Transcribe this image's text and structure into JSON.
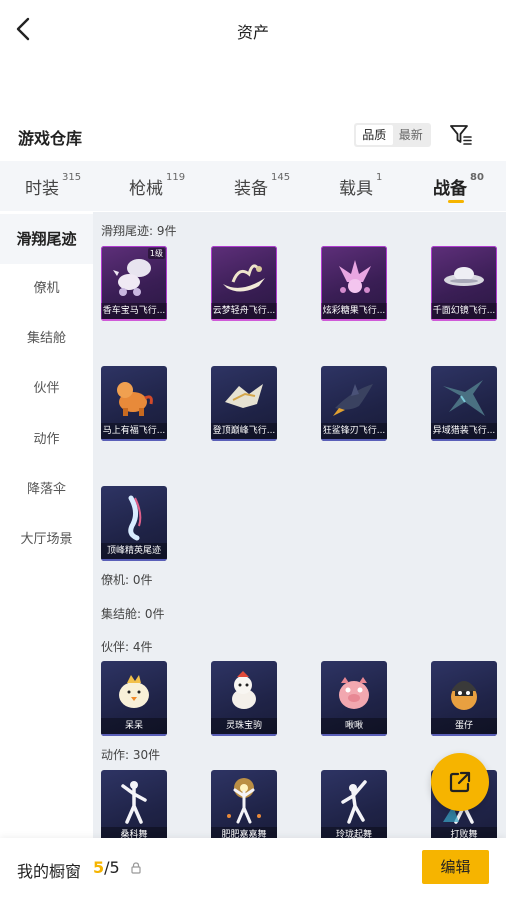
{
  "header": {
    "title": "资产"
  },
  "section": {
    "title": "游戏仓库",
    "sort_options": [
      "品质",
      "最新"
    ],
    "sort_active": "品质"
  },
  "tabs": [
    {
      "label": "时装",
      "count": "315"
    },
    {
      "label": "枪械",
      "count": "119"
    },
    {
      "label": "装备",
      "count": "145"
    },
    {
      "label": "载具",
      "count": "1"
    },
    {
      "label": "战备",
      "count": "80",
      "active": true
    }
  ],
  "sidebar": {
    "items": [
      {
        "label": "滑翔尾迹",
        "active": true
      },
      {
        "label": "僚机"
      },
      {
        "label": "集结舱"
      },
      {
        "label": "伙伴"
      },
      {
        "label": "动作"
      },
      {
        "label": "降落伞"
      },
      {
        "label": "大厅场景"
      }
    ]
  },
  "groups": {
    "glide": {
      "label": "滑翔尾迹: 9件",
      "items": [
        {
          "name": "香车宝马飞行...",
          "badge": "1级",
          "rarity": "purple",
          "icon": "horse-carriage-icon"
        },
        {
          "name": "云梦轻舟飞行...",
          "rarity": "purple",
          "icon": "lamp-boat-icon"
        },
        {
          "name": "炫彩糖果飞行...",
          "rarity": "purple",
          "icon": "candy-icon"
        },
        {
          "name": "千面幻镜飞行...",
          "rarity": "purple",
          "icon": "ufo-icon"
        },
        {
          "name": "马上有福飞行...",
          "rarity": "navy",
          "icon": "pony-icon"
        },
        {
          "name": "登顶巅峰飞行...",
          "rarity": "navy",
          "icon": "wings-icon"
        },
        {
          "name": "狂鲨锋刃飞行...",
          "rarity": "navy",
          "icon": "shark-icon"
        },
        {
          "name": "异域猎装飞行...",
          "rarity": "navy",
          "icon": "dragon-icon"
        },
        {
          "name": "顶峰精英尾迹",
          "rarity": "navy",
          "icon": "trail-icon"
        }
      ]
    },
    "drone": {
      "label": "僚机: 0件"
    },
    "pod": {
      "label": "集结舱: 0件"
    },
    "partner": {
      "label": "伙伴: 4件",
      "items": [
        {
          "name": "呆呆",
          "rarity": "navy",
          "icon": "chick-icon"
        },
        {
          "name": "灵珠宝驹",
          "rarity": "navy",
          "icon": "horse-icon"
        },
        {
          "name": "啾啾",
          "rarity": "navy",
          "icon": "pig-icon"
        },
        {
          "name": "蛋仔",
          "rarity": "navy",
          "icon": "egg-knight-icon"
        }
      ]
    },
    "emote": {
      "label": "动作: 30件",
      "items": [
        {
          "name": "桑科舞",
          "rarity": "navy",
          "icon": "dancer-icon"
        },
        {
          "name": "肥肥嘉嘉舞",
          "rarity": "navy",
          "icon": "firework-dancer-icon"
        },
        {
          "name": "玲珑起舞",
          "rarity": "navy",
          "icon": "dancer-icon"
        },
        {
          "name": "打败舞",
          "rarity": "navy",
          "icon": "dancer-icon"
        }
      ]
    }
  },
  "share": {
    "icon": "share-icon"
  },
  "bottom": {
    "label": "我的橱窗",
    "current": "5",
    "total": "/5",
    "edit_label": "编辑"
  },
  "colors": {
    "accent": "#f6b400",
    "purple_rarity": "#b03bd0",
    "content_bg": "#eceff3"
  }
}
